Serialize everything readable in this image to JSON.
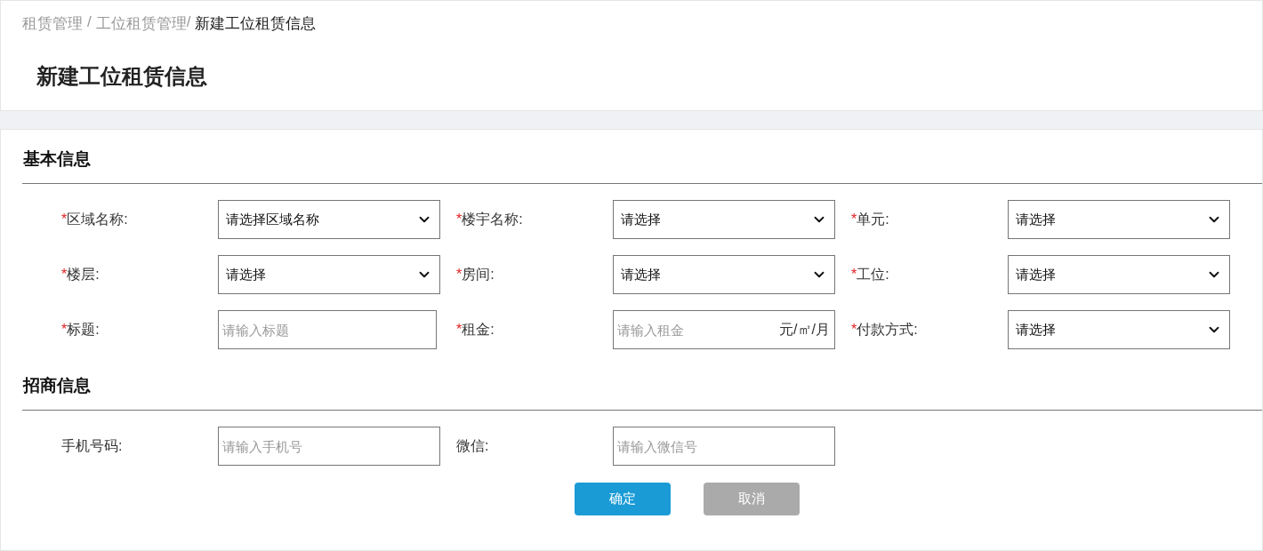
{
  "breadcrumb": [
    {
      "label": "租赁管理",
      "current": false,
      "separator": "/"
    },
    {
      "label": "工位租赁管理",
      "current": false,
      "separator": "/"
    },
    {
      "label": "新建工位租赁信息",
      "current": true
    }
  ],
  "required_mark": "*",
  "page_title": "新建工位租赁信息",
  "sections": [
    {
      "title": "基本信息",
      "rows": [
        [
          {
            "label": "区域名称:",
            "required": true,
            "kind": "select",
            "value": "请选择区域名称"
          },
          {
            "label": "楼宇名称:",
            "required": true,
            "kind": "select",
            "value": "请选择"
          },
          {
            "label": "单元:",
            "required": true,
            "kind": "select",
            "value": "请选择"
          }
        ],
        [
          {
            "label": "楼层:",
            "required": true,
            "kind": "select",
            "value": "请选择"
          },
          {
            "label": "房间:",
            "required": true,
            "kind": "select",
            "value": "请选择"
          },
          {
            "label": "工位:",
            "required": true,
            "kind": "select",
            "value": "请选择"
          }
        ],
        [
          {
            "label": "标题:",
            "required": true,
            "kind": "input",
            "placeholder": "请输入标题"
          },
          {
            "label": "租金:",
            "required": true,
            "kind": "input",
            "placeholder": "请输入租金",
            "suffix": "元/㎡/月"
          },
          {
            "label": "付款方式:",
            "required": true,
            "kind": "select",
            "value": "请选择"
          }
        ]
      ]
    },
    {
      "title": "招商信息",
      "rows": [
        [
          {
            "label": "手机号码:",
            "required": false,
            "kind": "input",
            "placeholder": "请输入手机号"
          },
          {
            "label": "微信:",
            "required": false,
            "kind": "input",
            "placeholder": "请输入微信号"
          }
        ]
      ]
    }
  ],
  "buttons": [
    {
      "label": "确定",
      "kind": "primary"
    },
    {
      "label": "取消",
      "kind": "secondary"
    }
  ]
}
